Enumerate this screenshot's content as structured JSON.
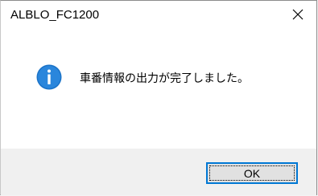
{
  "window": {
    "title": "ALBLO_FC1200"
  },
  "dialog": {
    "message": "車番情報の出力が完了しました。",
    "icon": "info-icon",
    "ok_label": "OK"
  },
  "colors": {
    "accent": "#0078d4",
    "info_icon_bg": "#1a73c8",
    "footer_bg": "#f0f0f0",
    "content_bg": "#ffffff"
  }
}
